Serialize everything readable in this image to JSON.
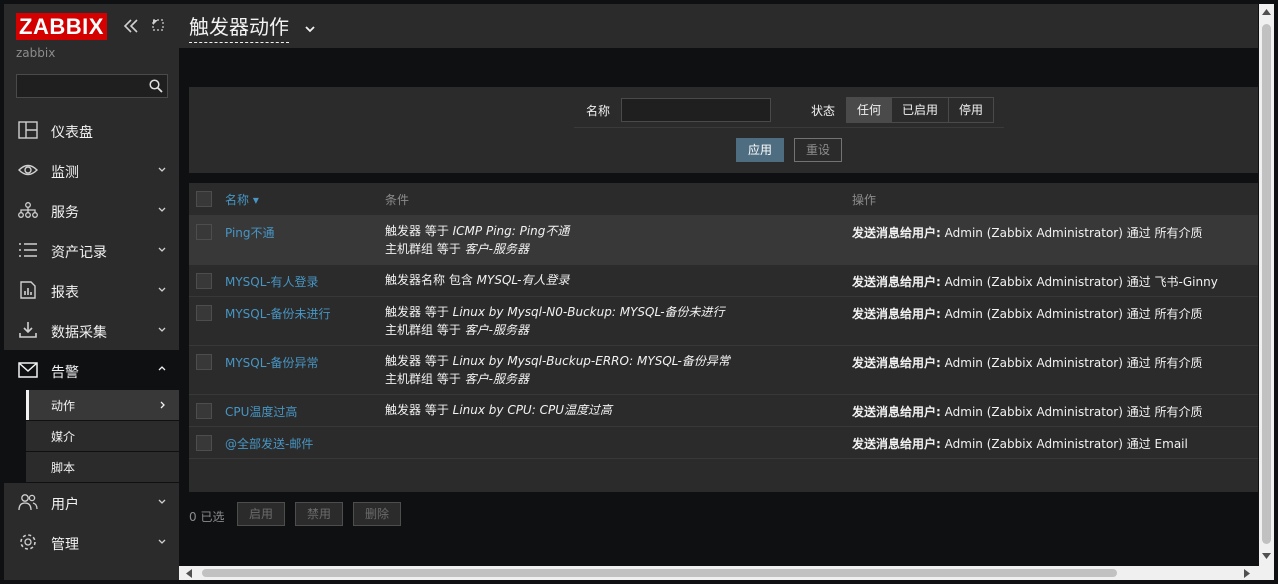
{
  "brand": {
    "logo": "ZABBIX",
    "server": "zabbix"
  },
  "sidebar": {
    "menu": [
      {
        "label": "仪表盘",
        "icon": "dashboard-icon"
      },
      {
        "label": "监测",
        "icon": "eye-icon"
      },
      {
        "label": "服务",
        "icon": "services-icon"
      },
      {
        "label": "资产记录",
        "icon": "list-icon"
      },
      {
        "label": "报表",
        "icon": "report-icon"
      },
      {
        "label": "数据采集",
        "icon": "download-icon"
      },
      {
        "label": "告警",
        "icon": "mail-icon"
      },
      {
        "label": "用户",
        "icon": "users-icon"
      },
      {
        "label": "管理",
        "icon": "gear-icon"
      }
    ],
    "submenu": [
      {
        "label": "动作"
      },
      {
        "label": "媒介"
      },
      {
        "label": "脚本"
      }
    ]
  },
  "header": {
    "title": "触发器动作"
  },
  "filter": {
    "name_label": "名称",
    "status_label": "状态",
    "status_options": [
      "任何",
      "已启用",
      "停用"
    ],
    "status_selected": "任何",
    "apply": "应用",
    "reset": "重设"
  },
  "table": {
    "columns": [
      "名称",
      "条件",
      "操作"
    ],
    "op_prefix": "发送消息给用户:",
    "rows": [
      {
        "name": "Ping不通",
        "cond": [
          {
            "plain": "触发器 等于 ",
            "em": "ICMP Ping: Ping不通"
          },
          {
            "plain": "主机群组 等于 ",
            "em": "客户-服务器"
          }
        ],
        "op": "Admin (Zabbix Administrator) 通过 所有介质"
      },
      {
        "name": "MYSQL-有人登录",
        "cond": [
          {
            "plain": "触发器名称 包含 ",
            "em": "MYSQL-有人登录"
          }
        ],
        "op": "Admin (Zabbix Administrator) 通过 飞书-Ginny"
      },
      {
        "name": "MYSQL-备份未进行",
        "cond": [
          {
            "plain": "触发器 等于 ",
            "em": "Linux by Mysql-N0-Buckup: MYSQL-备份未进行"
          },
          {
            "plain": "主机群组 等于 ",
            "em": "客户-服务器"
          }
        ],
        "op": "Admin (Zabbix Administrator) 通过 所有介质"
      },
      {
        "name": "MYSQL-备份异常",
        "cond": [
          {
            "plain": "触发器 等于 ",
            "em": "Linux by Mysql-Buckup-ERRO: MYSQL-备份异常"
          },
          {
            "plain": "主机群组 等于 ",
            "em": "客户-服务器"
          }
        ],
        "op": "Admin (Zabbix Administrator) 通过 所有介质"
      },
      {
        "name": "CPU温度过高",
        "cond": [
          {
            "plain": "触发器 等于 ",
            "em": "Linux by CPU: CPU温度过高"
          }
        ],
        "op": "Admin (Zabbix Administrator) 通过 所有介质"
      },
      {
        "name": "@全部发送-邮件",
        "cond": [],
        "op": "Admin (Zabbix Administrator) 通过 Email"
      }
    ]
  },
  "footer": {
    "selected": "0 已选",
    "buttons": [
      "启用",
      "禁用",
      "删除"
    ]
  }
}
